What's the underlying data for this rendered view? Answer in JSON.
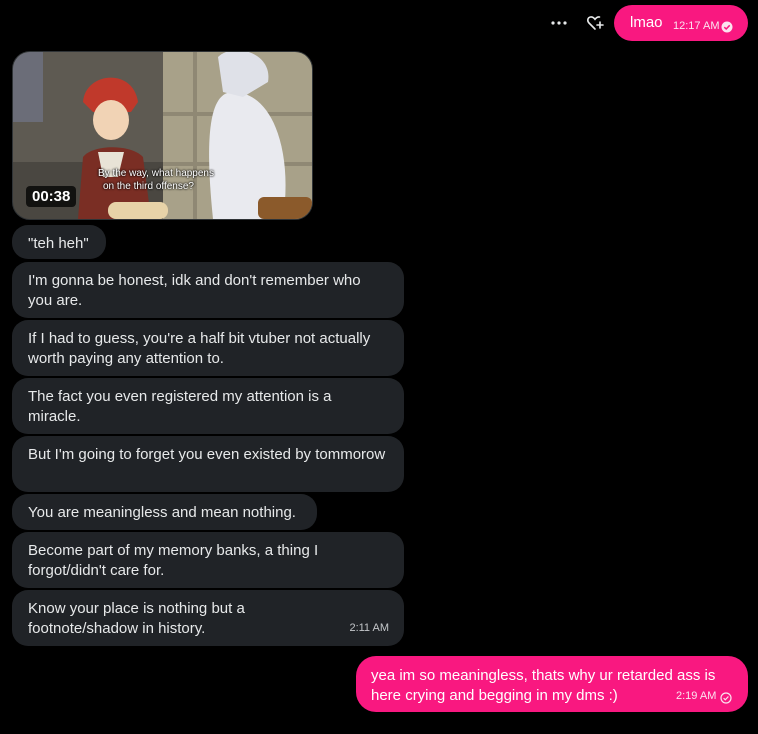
{
  "header_message": {
    "text": "lmao",
    "time": "12:17 AM",
    "more_icon": "more-horizontal-icon",
    "react_icon": "heart-plus-icon",
    "status_icon": "check-circle-icon"
  },
  "video": {
    "duration": "00:38",
    "subtitle_line1": "By the way, what happens",
    "subtitle_line2": "on the third offense?"
  },
  "incoming_messages": [
    {
      "text": "\"teh heh\""
    },
    {
      "text": "I'm gonna be honest, idk and don't remember who you are."
    },
    {
      "text": "If I had to guess, you're a half bit vtuber not actually worth paying any attention to."
    },
    {
      "text": "The fact you even registered my attention is a miracle."
    },
    {
      "text": "But I'm going to forget you even existed by tommorow"
    },
    {
      "text": "You are meaningless and mean nothing."
    },
    {
      "text": "Become part of my memory banks, a thing I forgot/didn't care for."
    },
    {
      "text": "Know your place is nothing but a footnote/shadow in history.",
      "time": "2:11 AM"
    }
  ],
  "outgoing_reply": {
    "text": "yea im so meaningless, thats why ur retarded ass is here crying and begging in my dms :)",
    "time": "2:19 AM",
    "status_icon": "check-circle-outline-icon"
  },
  "colors": {
    "background": "#000000",
    "outgoing_bubble": "#f91880",
    "incoming_bubble": "#202327"
  }
}
